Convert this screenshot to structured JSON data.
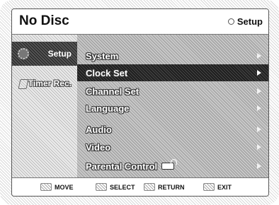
{
  "header": {
    "title": "No Disc",
    "right_label": "Setup",
    "right_icon": "ring-icon"
  },
  "sidebar": {
    "items": [
      {
        "label": "Setup",
        "icon": "gear-icon",
        "active": true
      },
      {
        "label": "Timer Rec.",
        "icon": "timer-rec-icon",
        "active": false
      }
    ]
  },
  "menu": {
    "items": [
      {
        "label": "System"
      },
      {
        "label": "Clock Set"
      },
      {
        "label": "Channel Set"
      },
      {
        "label": "Language"
      },
      {
        "label": "Audio"
      },
      {
        "label": "Video"
      },
      {
        "label": "Parental Control"
      }
    ],
    "selected_label": "Clock Set"
  },
  "footer": {
    "move": "MOVE",
    "select": "SELECT",
    "return": "RETURN",
    "exit": "EXIT"
  }
}
